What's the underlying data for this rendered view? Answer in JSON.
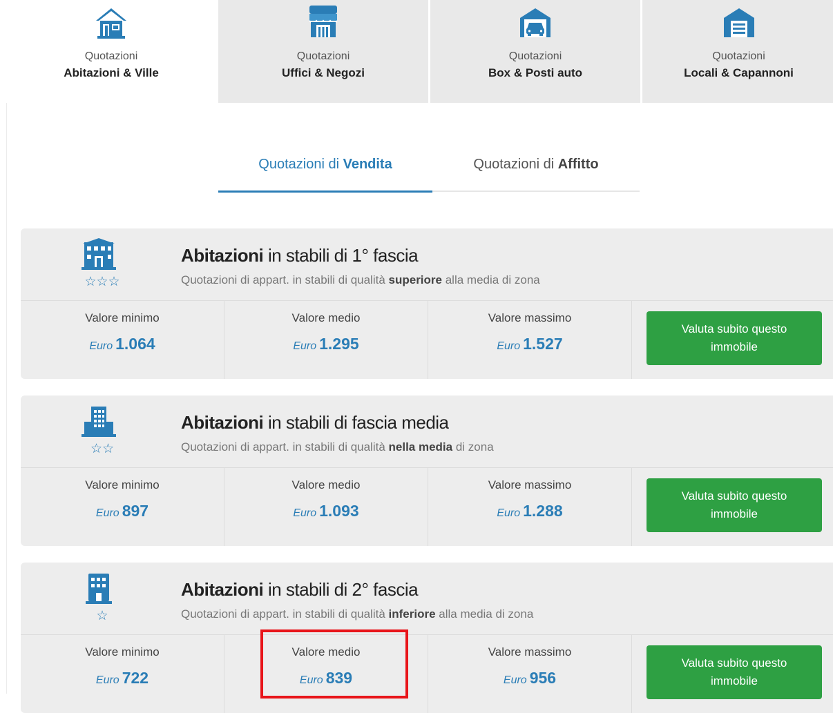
{
  "category_tabs": [
    {
      "line1": "Quotazioni",
      "line2": "Abitazioni & Ville",
      "icon": "house-icon",
      "active": true
    },
    {
      "line1": "Quotazioni",
      "line2": "Uffici & Negozi",
      "icon": "shop-icon",
      "active": false
    },
    {
      "line1": "Quotazioni",
      "line2": "Box & Posti auto",
      "icon": "garage-icon",
      "active": false
    },
    {
      "line1": "Quotazioni",
      "line2": "Locali & Capannoni",
      "icon": "warehouse-icon",
      "active": false
    }
  ],
  "sub_tabs": {
    "sale": {
      "prefix": "Quotazioni di ",
      "bold": "Vendita",
      "active": true
    },
    "rent": {
      "prefix": "Quotazioni di ",
      "bold": "Affitto",
      "active": false
    }
  },
  "cards": [
    {
      "title_bold": "Abitazioni",
      "title_rest": " in stabili di 1° fascia",
      "sub_pre": "Quotazioni di appart. in stabili di qualità ",
      "sub_bold": "superiore",
      "sub_post": " alla media di zona",
      "stars": "☆☆☆",
      "icon": "building-icon",
      "min": {
        "label": "Valore minimo",
        "currency": "Euro",
        "value": "1.064"
      },
      "avg": {
        "label": "Valore medio",
        "currency": "Euro",
        "value": "1.295"
      },
      "max": {
        "label": "Valore massimo",
        "currency": "Euro",
        "value": "1.527"
      },
      "cta": "Valuta subito questo immobile"
    },
    {
      "title_bold": "Abitazioni",
      "title_rest": " in stabili di fascia media",
      "sub_pre": "Quotazioni di appart. in stabili di qualità ",
      "sub_bold": "nella media",
      "sub_post": " di zona",
      "stars": "☆☆",
      "icon": "building-icon",
      "min": {
        "label": "Valore minimo",
        "currency": "Euro",
        "value": "897"
      },
      "avg": {
        "label": "Valore medio",
        "currency": "Euro",
        "value": "1.093"
      },
      "max": {
        "label": "Valore massimo",
        "currency": "Euro",
        "value": "1.288"
      },
      "cta": "Valuta subito questo immobile"
    },
    {
      "title_bold": "Abitazioni",
      "title_rest": " in stabili di 2° fascia",
      "sub_pre": "Quotazioni di appart. in stabili di qualità ",
      "sub_bold": "inferiore",
      "sub_post": " alla media di zona",
      "stars": "☆",
      "icon": "building-icon",
      "min": {
        "label": "Valore minimo",
        "currency": "Euro",
        "value": "722"
      },
      "avg": {
        "label": "Valore medio",
        "currency": "Euro",
        "value": "839"
      },
      "max": {
        "label": "Valore massimo",
        "currency": "Euro",
        "value": "956"
      },
      "cta": "Valuta subito questo immobile"
    }
  ],
  "colors": {
    "accent": "#2a7db6",
    "cta": "#2ea043",
    "highlight": "#e8151a",
    "card_bg": "#ededed",
    "tab_bg": "#e9e9e9"
  }
}
